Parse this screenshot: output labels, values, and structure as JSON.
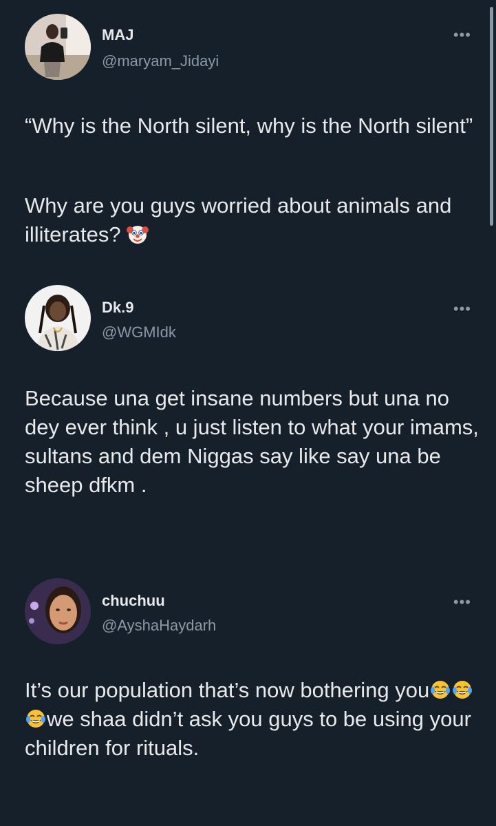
{
  "tweets": [
    {
      "display_name": "MAJ",
      "handle": "@maryam_Jidayi",
      "paragraph1": "“Why is the North silent, why is the North silent”",
      "paragraph2": "Why are you guys worried about animals and illiterates?",
      "emoji": "clown-face-icon"
    },
    {
      "display_name": "Dk.9",
      "handle": "@WGMIdk",
      "paragraph1": "Because una get insane numbers but una no dey ever think , u just listen to what your imams, sultans  and dem Niggas say like say una be sheep dfkm ."
    },
    {
      "display_name": "chuchuu",
      "handle": "@AyshaHaydarh",
      "text_before_emoji": "It’s our population that’s now bothering you",
      "emoji": "face-with-tears-of-joy-icon",
      "emoji_count": 3,
      "text_after_emoji": "we shaa didn’t ask you guys to be using your children for rituals."
    }
  ],
  "more_menu_glyph": "•••",
  "colors": {
    "background": "#15202b",
    "primary_text": "#e7e9ea",
    "secondary_text": "#8b98a5"
  }
}
